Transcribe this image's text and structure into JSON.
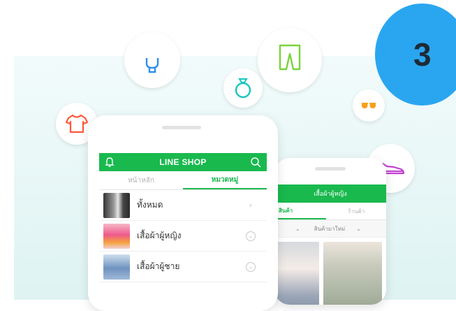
{
  "badge": {
    "number": "3"
  },
  "back_screen": {
    "header_title": "เสื้อผ้าผู้หญิง",
    "tabs": [
      "สินค้า",
      "ร้านค้า"
    ],
    "filter_label": "สินค้ามาใหม่"
  },
  "front_screen": {
    "header_title": "LINE SHOP",
    "tabs": [
      {
        "label": "หน้าหลัก",
        "active": false
      },
      {
        "label": "หมวดหมู่",
        "active": true
      }
    ],
    "categories": [
      {
        "label": "ทั้งหมด",
        "control": "chevron-right"
      },
      {
        "label": "เสื้อผ้าผู้หญิง",
        "control": "chevron-down-circle"
      },
      {
        "label": "เสื้อผ้าผู้ชาย",
        "control": "chevron-down-circle"
      }
    ]
  },
  "colors": {
    "brand_green": "#19b94e",
    "badge_blue": "#2aa6f0",
    "background_mint": "#def3f2"
  },
  "floating_icons": [
    "shirt-icon",
    "lightbulb-icon",
    "ring-icon",
    "pants-icon",
    "sunglasses-icon",
    "shoe-icon"
  ]
}
